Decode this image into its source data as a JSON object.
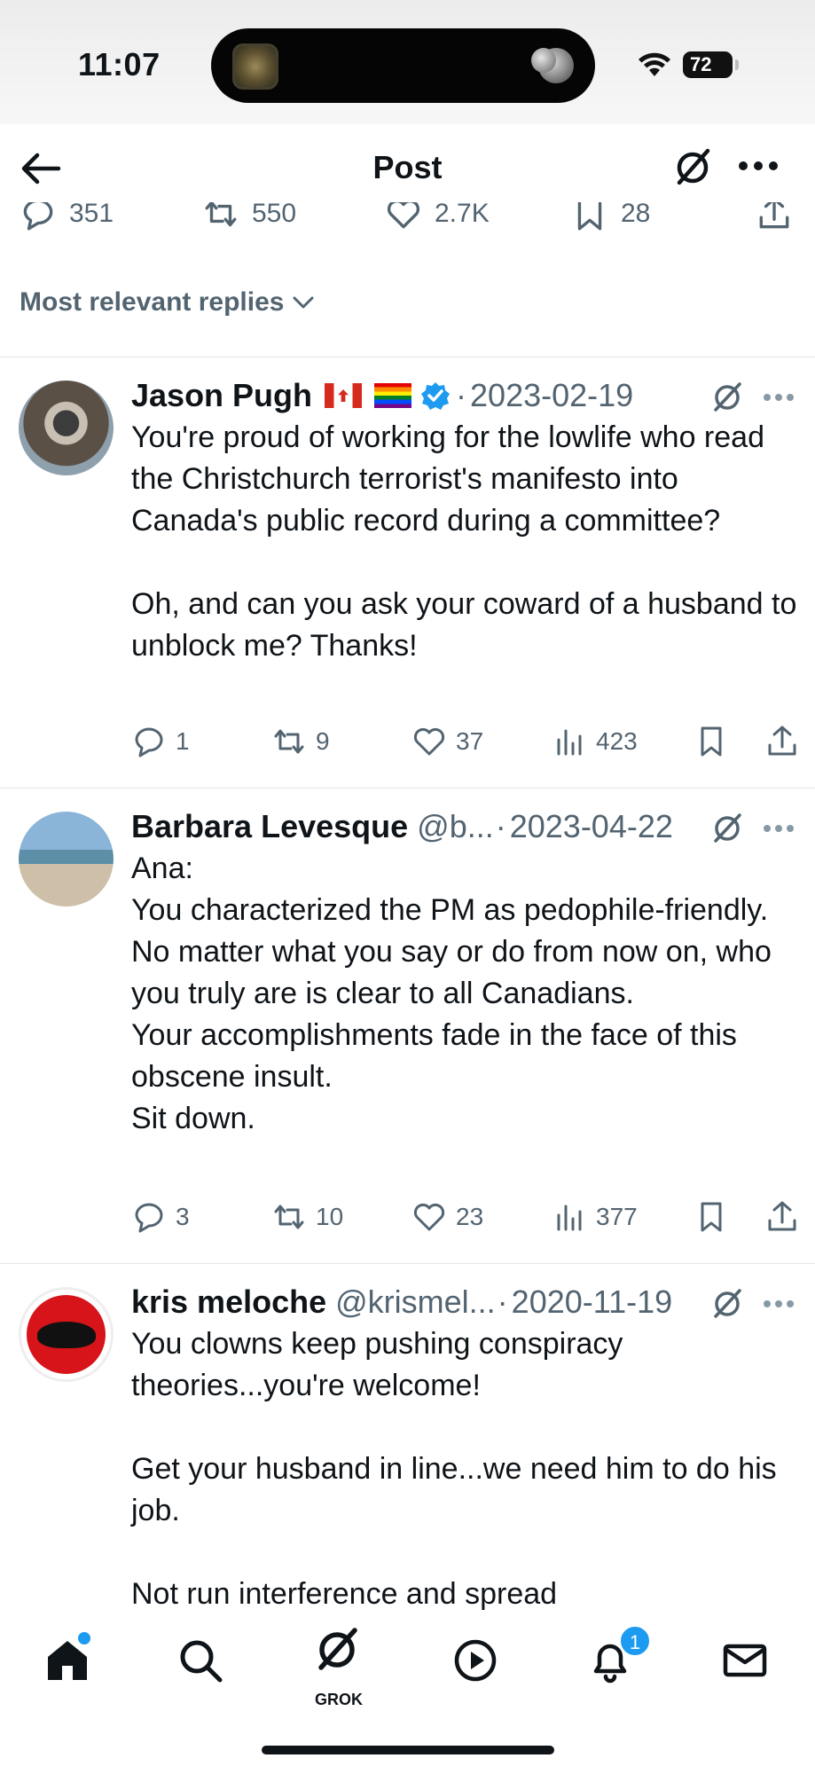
{
  "status_bar": {
    "time": "11:07",
    "battery": "72"
  },
  "header": {
    "title": "Post"
  },
  "main_post_stats": {
    "replies": "351",
    "reposts": "550",
    "likes": "2.7K",
    "bookmarks": "28"
  },
  "sort": {
    "label": "Most relevant replies"
  },
  "replies": [
    {
      "name": "Jason Pugh",
      "handle": "",
      "separator": "·",
      "date": "2023-02-19",
      "text": "You're proud of working for the lowlife who read the Christchurch terrorist's manifesto into Canada's public record during a committee?\n\nOh, and can you ask your coward of a husband to unblock me? Thanks!",
      "stats": {
        "replies": "1",
        "reposts": "9",
        "likes": "37",
        "views": "423"
      }
    },
    {
      "name": "Barbara Levesque",
      "handle": "@b...",
      "separator": "·",
      "date": "2023-04-22",
      "text": "Ana:\nYou characterized the PM as pedophile-friendly.\nNo matter what you say or do from now on, who you truly are is clear to all Canadians.\nYour accomplishments fade in the face of this obscene insult.\nSit down.",
      "stats": {
        "replies": "3",
        "reposts": "10",
        "likes": "23",
        "views": "377"
      }
    },
    {
      "name": "kris meloche",
      "handle": "@krismel...",
      "separator": "·",
      "date": "2020-11-19",
      "text": "You clowns keep pushing conspiracy theories...you're welcome!\n\nGet your husband in line...we need him to do his job.\n\nNot run interference and spread"
    }
  ],
  "tabbar": {
    "grok_label": "GROK",
    "notification_count": "1"
  },
  "colors": {
    "accent": "#1d9bf0",
    "text": "#0f1419",
    "secondary": "#536471",
    "divider": "#e1e6ea"
  }
}
